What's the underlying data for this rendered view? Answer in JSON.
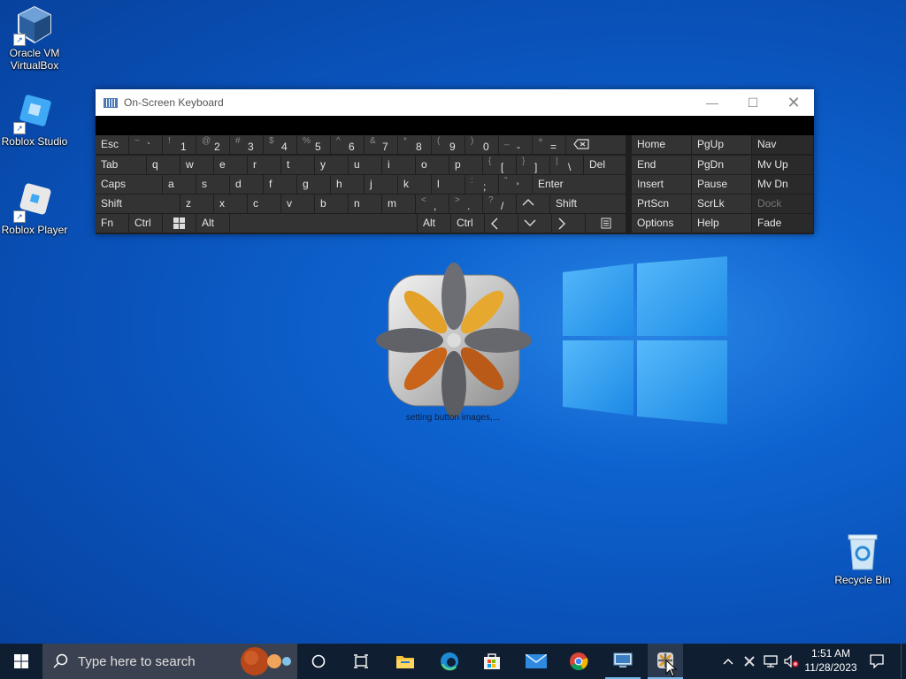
{
  "desktop": {
    "icons": [
      {
        "label": "Oracle VM VirtualBox"
      },
      {
        "label": "Roblox Studio"
      },
      {
        "label": "Roblox Player"
      },
      {
        "label": "Recycle Bin"
      }
    ]
  },
  "osk": {
    "title": "On-Screen Keyboard",
    "row1": [
      {
        "label": "Esc"
      },
      {
        "shift": "~",
        "main": "`"
      },
      {
        "shift": "!",
        "main": "1"
      },
      {
        "shift": "@",
        "main": "2"
      },
      {
        "shift": "#",
        "main": "3"
      },
      {
        "shift": "$",
        "main": "4"
      },
      {
        "shift": "%",
        "main": "5"
      },
      {
        "shift": "^",
        "main": "6"
      },
      {
        "shift": "&",
        "main": "7"
      },
      {
        "shift": "*",
        "main": "8"
      },
      {
        "shift": "(",
        "main": "9"
      },
      {
        "shift": ")",
        "main": "0"
      },
      {
        "shift": "_",
        "main": "-"
      },
      {
        "shift": "+",
        "main": "="
      }
    ],
    "row2": [
      "Tab",
      "q",
      "w",
      "e",
      "r",
      "t",
      "y",
      "u",
      "i",
      "o",
      "p"
    ],
    "row2_brackets": [
      {
        "shift": "{",
        "main": "["
      },
      {
        "shift": "}",
        "main": "]"
      },
      {
        "shift": "|",
        "main": "\\"
      }
    ],
    "row2_del": "Del",
    "row3": [
      "Caps",
      "a",
      "s",
      "d",
      "f",
      "g",
      "h",
      "j",
      "k",
      "l"
    ],
    "row3_punct": [
      {
        "shift": ":",
        "main": ";"
      },
      {
        "shift": "\"",
        "main": "'"
      }
    ],
    "row3_enter": "Enter",
    "row4": [
      "Shift",
      "z",
      "x",
      "c",
      "v",
      "b",
      "n",
      "m"
    ],
    "row4_punct": [
      {
        "shift": "<",
        "main": ","
      },
      {
        "shift": ">",
        "main": "."
      },
      {
        "shift": "?",
        "main": "/"
      }
    ],
    "row4_shift_right": "Shift",
    "row5": {
      "fn": "Fn",
      "ctrl": "Ctrl",
      "alt": "Alt",
      "alt_right": "Alt",
      "ctrl_right": "Ctrl"
    },
    "nav_keys": [
      [
        "Home",
        "PgUp",
        "Nav"
      ],
      [
        "End",
        "PgDn",
        "Mv Up"
      ],
      [
        "Insert",
        "Pause",
        "Mv Dn"
      ],
      [
        "PrtScn",
        "ScrLk",
        "Dock"
      ],
      [
        "Options",
        "Help",
        "Fade"
      ]
    ]
  },
  "splash": {
    "status": "setting button images,..."
  },
  "taskbar": {
    "search_placeholder": "Type here to search",
    "time": "1:51 AM",
    "date": "11/28/2023"
  }
}
